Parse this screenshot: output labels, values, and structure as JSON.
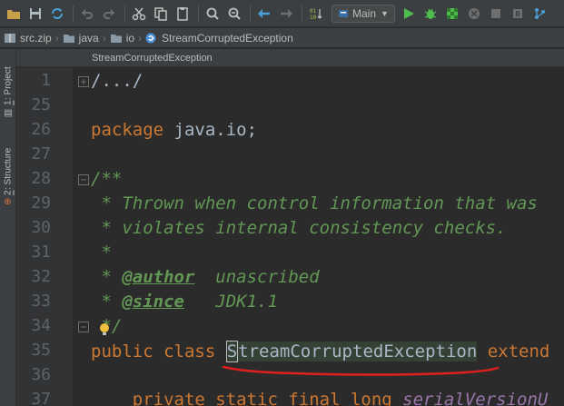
{
  "toolbar": {
    "run_config": "Main"
  },
  "breadcrumb": [
    {
      "label": "src.zip"
    },
    {
      "label": "java"
    },
    {
      "label": "io"
    },
    {
      "label": "StreamCorruptedException"
    }
  ],
  "tab": {
    "label": "StreamCorruptedException"
  },
  "side_tabs": {
    "project_num": "1",
    "project_label": ": Project",
    "structure_num": "2",
    "structure_label": ": Structure"
  },
  "gutter": {
    "line_numbers": [
      "1",
      "25",
      "26",
      "27",
      "28",
      "29",
      "30",
      "31",
      "32",
      "33",
      "34",
      "35",
      "36",
      "37"
    ]
  },
  "code": {
    "l1": "/.../",
    "l26_kw": "package",
    "l26_rest": " java.io;",
    "l28": "/**",
    "l29": " * Thrown when control information that was",
    "l30": " * violates internal consistency checks.",
    "l31": " *",
    "l32_pre": " * ",
    "l32_tag": "@author",
    "l32_rest": "  unascribed",
    "l33_pre": " * ",
    "l33_tag": "@since",
    "l33_rest": "   JDK1.1",
    "l34": " */",
    "l35_kw": "public class ",
    "l35_caret": "S",
    "l35_name": "treamCorruptedException",
    "l35_rest": " extend",
    "l37_kw": "    private static final long ",
    "l37_fld": "serialVersionU"
  },
  "colors": {
    "keyword": "#cc7832",
    "doc": "#629755",
    "annotation_underline": "#e0201c"
  }
}
